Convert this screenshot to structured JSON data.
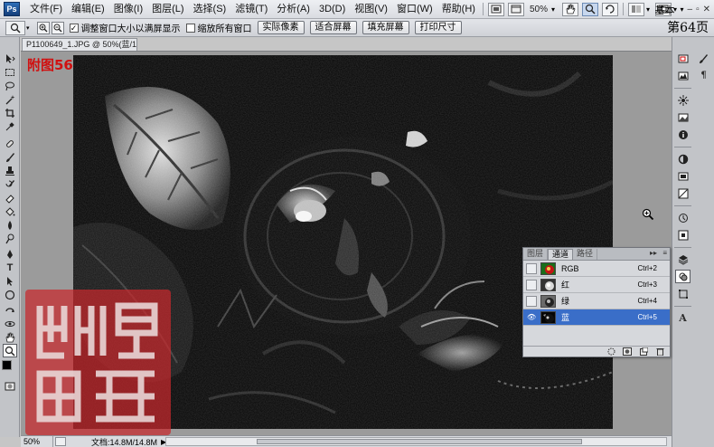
{
  "menubar": {
    "logo": "Ps",
    "items": [
      "文件(F)",
      "编辑(E)",
      "图像(I)",
      "图层(L)",
      "选择(S)",
      "滤镜(T)",
      "分析(A)",
      "3D(D)",
      "视图(V)",
      "窗口(W)",
      "帮助(H)"
    ],
    "zoom": "50%",
    "workspace": "基本"
  },
  "options": {
    "check1_label": "调整窗口大小以满屏显示",
    "check2_label": "缩放所有窗口",
    "buttons": [
      "实际像素",
      "适合屏幕",
      "填充屏幕",
      "打印尺寸"
    ],
    "page_number": "第64页"
  },
  "document": {
    "tab_title": "P1100649_1.JPG @ 50%(蓝/16)",
    "figure_label": "附图56"
  },
  "status": {
    "zoom": "50%",
    "doc_size": "文档:14.8M/14.8M"
  },
  "channels_panel": {
    "tabs": [
      "图层",
      "通道",
      "路径"
    ],
    "active_tab": 1,
    "rows": [
      {
        "name": "RGB",
        "shortcut": "Ctrl+2",
        "visible": false,
        "selected": false
      },
      {
        "name": "红",
        "shortcut": "Ctrl+3",
        "visible": false,
        "selected": false
      },
      {
        "name": "绿",
        "shortcut": "Ctrl+4",
        "visible": false,
        "selected": false
      },
      {
        "name": "蓝",
        "shortcut": "Ctrl+5",
        "visible": true,
        "selected": true
      }
    ]
  },
  "colors": {
    "selection": "#3a6ec8",
    "figure_label": "#d01010",
    "seal": "#c8282c"
  }
}
